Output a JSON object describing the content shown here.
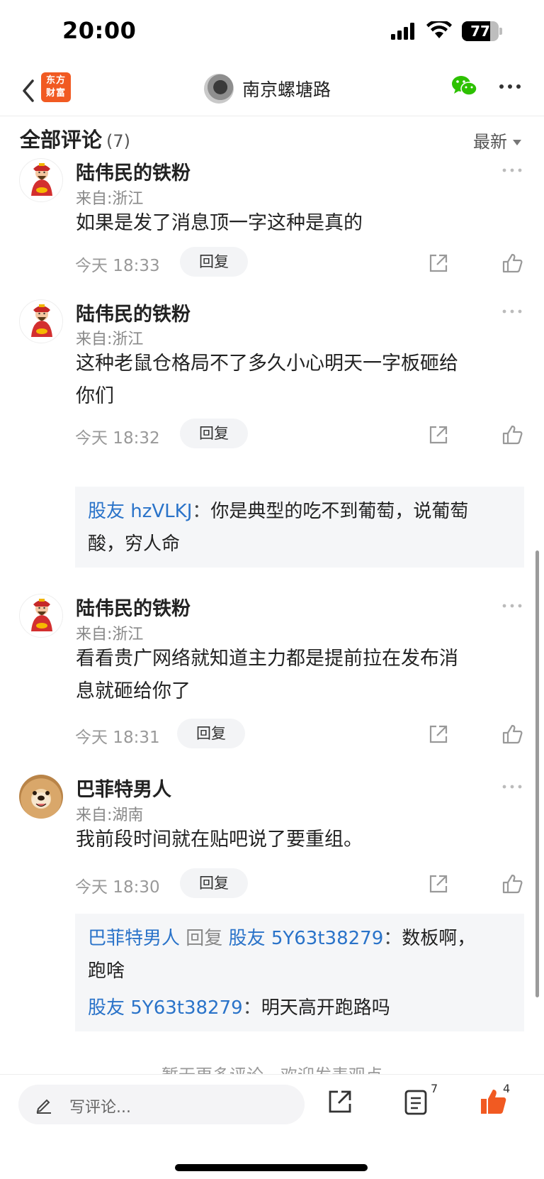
{
  "status_bar": {
    "time": "20:00",
    "battery": "77",
    "battery_level": 0.77
  },
  "nav": {
    "logo_line1": "东方",
    "logo_line2": "财富",
    "title": "南京螺塘路"
  },
  "section": {
    "title": "全部评论",
    "count": "(7)",
    "sort_label": "最新"
  },
  "comments": [
    {
      "name": "陆伟民的铁粉",
      "location": "来自:浙江",
      "text": "如果是发了消息顶一字这种是真的",
      "time": "今天 18:33",
      "reply_label": "回复",
      "avatar": "fortune-god-avatar"
    },
    {
      "name": "陆伟民的铁粉",
      "location": "来自:浙江",
      "text_lines": [
        "这种老鼠仓格局不了多久小心明天一字板砸给",
        "你们"
      ],
      "time": "今天 18:32",
      "reply_label": "回复",
      "avatar": "fortune-god-avatar",
      "replies": [
        {
          "user": "股友 hzVLKJ",
          "sep": "：",
          "text_lines": [
            "你是典型的吃不到葡萄，说葡萄",
            "酸，穷人命"
          ]
        }
      ]
    },
    {
      "name": "陆伟民的铁粉",
      "location": "来自:浙江",
      "text_lines": [
        "看看贵广网络就知道主力都是提前拉在发布消",
        "息就砸给你了"
      ],
      "time": "今天 18:31",
      "reply_label": "回复",
      "avatar": "fortune-god-avatar"
    },
    {
      "name": "巴菲特男人",
      "location": "来自:湖南",
      "text": "我前段时间就在贴吧说了要重组。",
      "time": "今天 18:30",
      "reply_label": "回复",
      "avatar": "dog-avatar",
      "replies": [
        {
          "user": "巴菲特男人",
          "reply_word": "回复",
          "target": "股友 5Y63t38279",
          "sep": "：",
          "text_lines": [
            "数板啊，",
            "跑啥"
          ]
        },
        {
          "user": "股友 5Y63t38279",
          "sep": "：",
          "text": "明天高开跑路吗"
        }
      ]
    }
  ],
  "end_hint": "暂无更多评论，欢迎发表观点",
  "bottom_bar": {
    "write_placeholder": "写评论...",
    "list_count": "7",
    "like_count": "4"
  },
  "colors": {
    "brand": "#f15a22",
    "link": "#2a73c9",
    "like_active": "#f15a22",
    "wechat": "#2dc100"
  }
}
